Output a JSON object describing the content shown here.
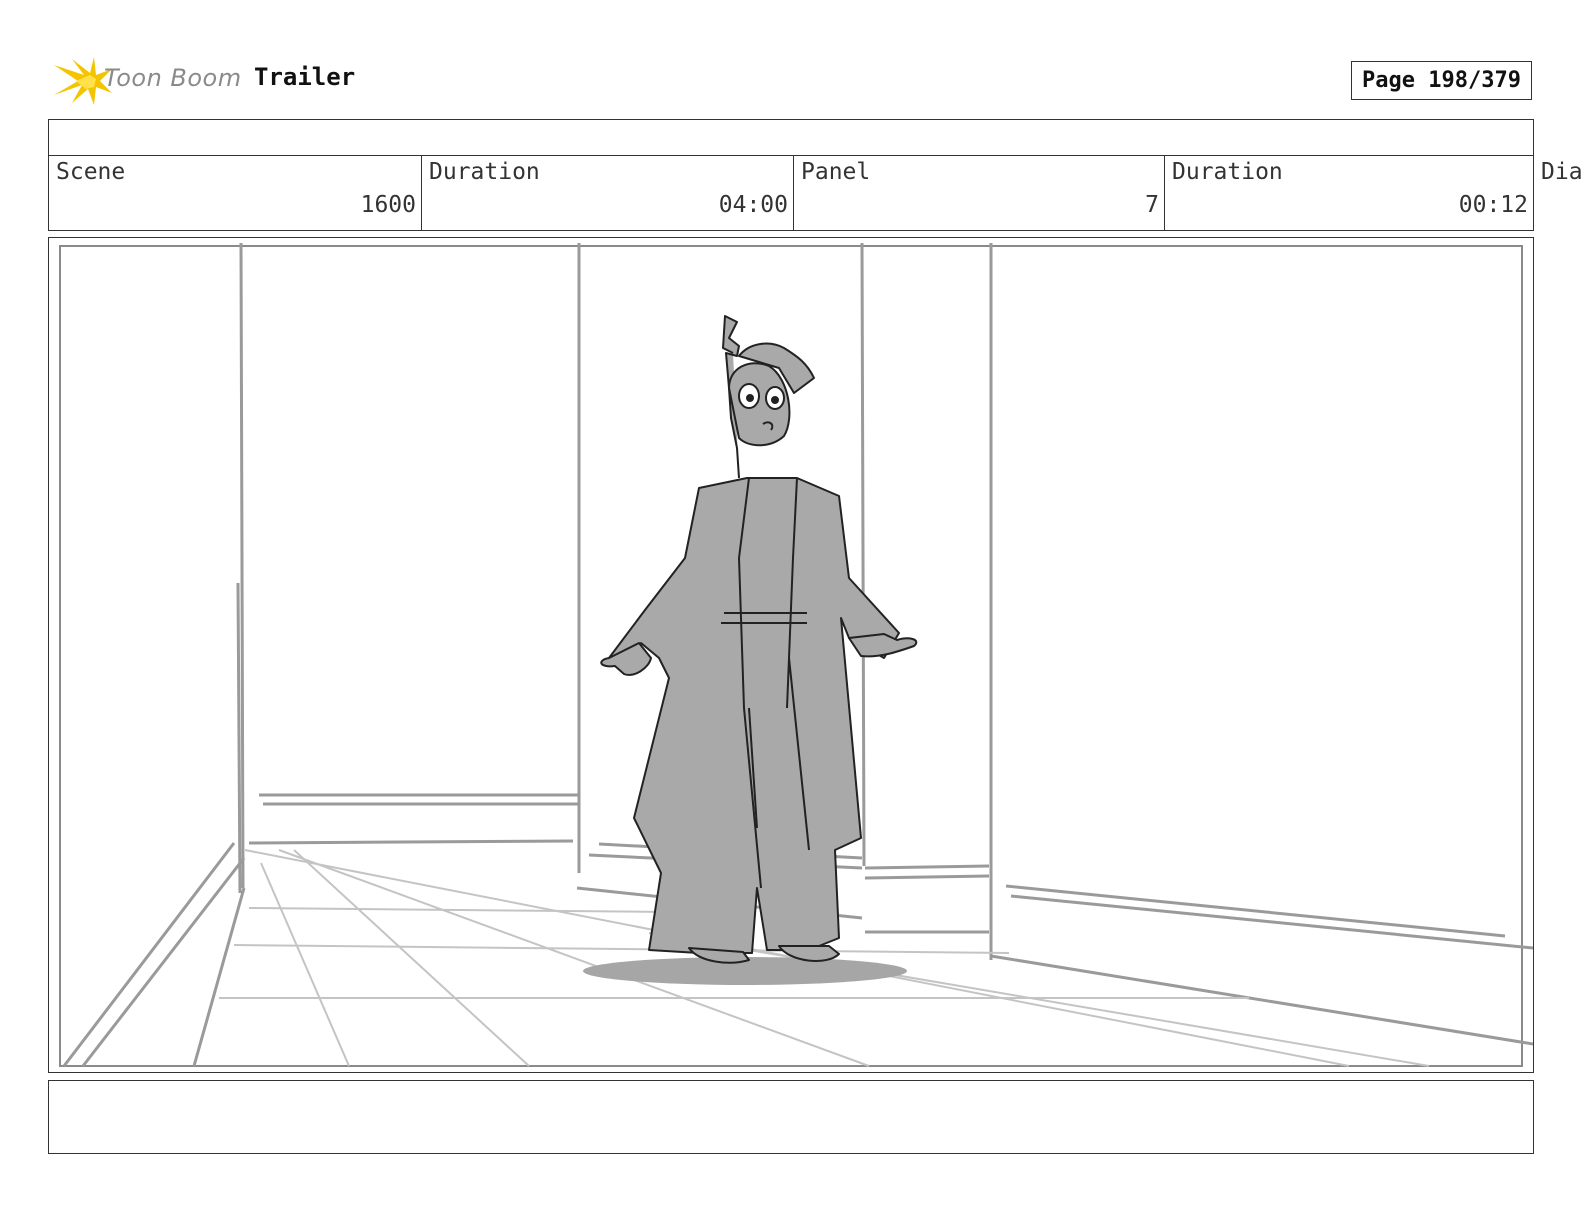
{
  "header": {
    "logo_text": "Toon Boom",
    "project_title": "Trailer",
    "page_indicator": "Page 198/379"
  },
  "info": {
    "scene_label": "Scene",
    "scene_value": "1600",
    "scene_duration_label": "Duration",
    "scene_duration_value": "04:00",
    "panel_label": "Panel",
    "panel_value": "7",
    "panel_duration_label": "Duration",
    "panel_duration_value": "00:12",
    "overflow_label": "Dia"
  },
  "colors": {
    "logo_star": "#f5c400",
    "logo_star_inner": "#ffe24a",
    "character_fill": "#a9a9a9",
    "line": "#222222",
    "background_line": "#9a9a9a"
  },
  "icons": {
    "logo": "toon-boom-star-icon"
  }
}
